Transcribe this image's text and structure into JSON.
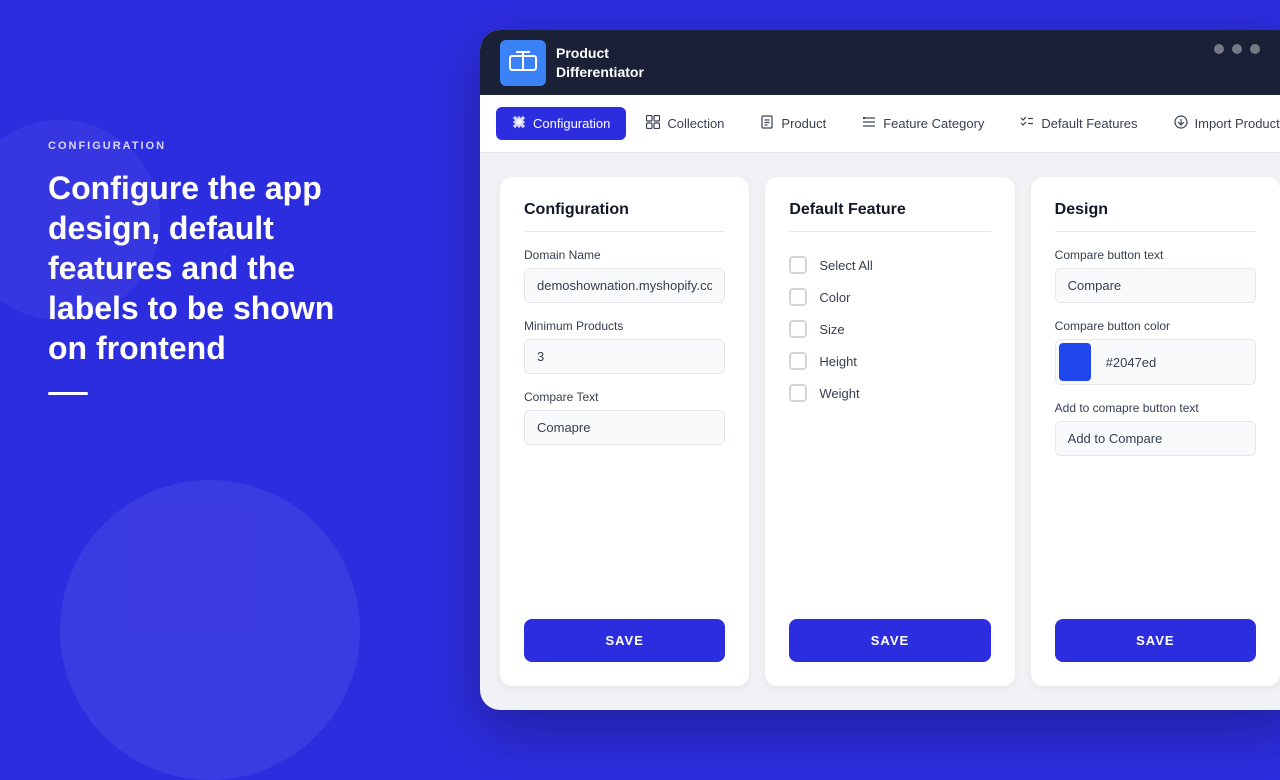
{
  "page": {
    "background_label": "CONFIGURATION",
    "background_heading": "Configure the app design, default features and the labels to be shown on frontend"
  },
  "app": {
    "logo_icon": "⚖",
    "logo_line1": "Product",
    "logo_line2": "Differentiator"
  },
  "nav": {
    "tabs": [
      {
        "id": "configuration",
        "label": "Configuration",
        "icon": "⚙",
        "active": true
      },
      {
        "id": "collection",
        "label": "Collection",
        "icon": "▦"
      },
      {
        "id": "product",
        "label": "Product",
        "icon": "🛍"
      },
      {
        "id": "feature-category",
        "label": "Feature Category",
        "icon": "≡"
      },
      {
        "id": "default-features",
        "label": "Default Features",
        "icon": "✓≡"
      },
      {
        "id": "import-products",
        "label": "Import Products",
        "icon": "✓"
      }
    ]
  },
  "config_card": {
    "title": "Configuration",
    "domain_label": "Domain Name",
    "domain_value": "demoshownation.myshopify.com",
    "min_products_label": "Minimum Products",
    "min_products_value": "3",
    "compare_text_label": "Compare Text",
    "compare_text_value": "Comapre",
    "save_label": "SAVE"
  },
  "default_feature_card": {
    "title": "Default Feature",
    "select_all_label": "Select All",
    "features": [
      {
        "label": "Color"
      },
      {
        "label": "Size"
      },
      {
        "label": "Height"
      },
      {
        "label": "Weight"
      }
    ],
    "save_label": "SAVE"
  },
  "design_card": {
    "title": "Design",
    "compare_btn_text_label": "Compare button text",
    "compare_btn_text_value": "Compare",
    "compare_btn_color_label": "Compare button color",
    "compare_btn_color_hex": "#2047ed",
    "add_compare_label": "Add to comapre button text",
    "add_compare_value": "Add to Compare",
    "save_label": "SAVE"
  }
}
